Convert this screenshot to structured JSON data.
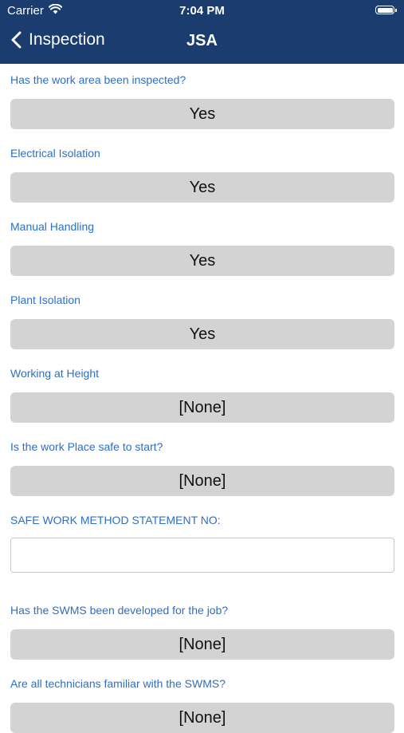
{
  "status_bar": {
    "carrier": "Carrier",
    "time": "7:04 PM"
  },
  "nav": {
    "back_label": "Inspection",
    "title": "JSA"
  },
  "fields": [
    {
      "label": "Has the work area been inspected?",
      "value": "Yes"
    },
    {
      "label": "Electrical Isolation",
      "value": "Yes"
    },
    {
      "label": "Manual Handling",
      "value": "Yes"
    },
    {
      "label": "Plant Isolation",
      "value": "Yes"
    },
    {
      "label": "Working at Height",
      "value": "[None]"
    },
    {
      "label": "Is the work Place safe to start?",
      "value": "[None]"
    },
    {
      "label": "SAFE WORK METHOD STATEMENT NO:",
      "value": ""
    },
    {
      "label": "Has the SWMS been developed for the job?",
      "value": "[None]"
    },
    {
      "label": "Are all technicians familiar with the SWMS?",
      "value": "[None]"
    }
  ],
  "colors": {
    "header": "#1b3c6e",
    "label": "#2d6fc4",
    "button": "#d3d3d3"
  }
}
